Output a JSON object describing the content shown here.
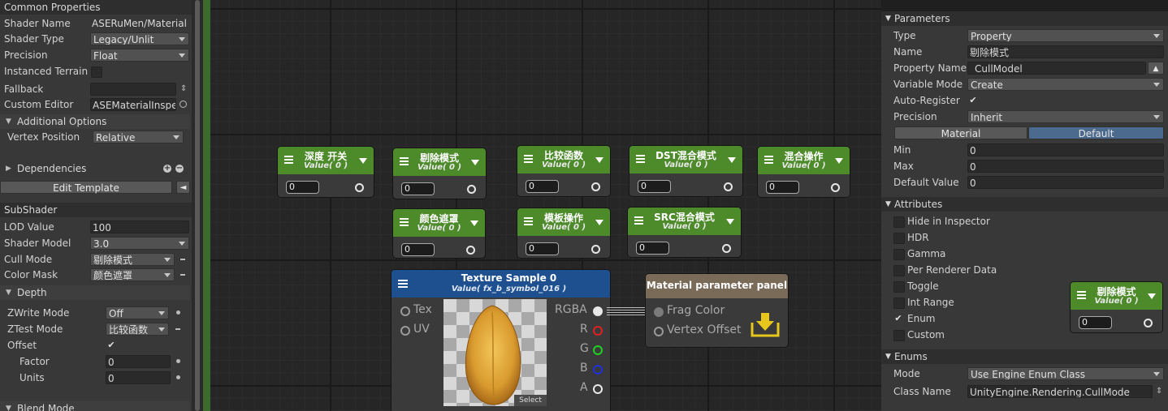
{
  "left_panel": {
    "common_properties": "Common Properties",
    "shader_name_label": "Shader Name",
    "shader_name_value": "ASERuMen/Material",
    "shader_type_label": "Shader Type",
    "shader_type_value": "Legacy/Unlit",
    "precision_label": "Precision",
    "precision_value": "Float",
    "instanced_terrain_label": "Instanced Terrain",
    "fallback_label": "Fallback",
    "fallback_value": "",
    "custom_editor_label": "Custom Editor",
    "custom_editor_value": "ASEMaterialInspe",
    "additional_options": "Additional Options",
    "vertex_position_label": "Vertex Position",
    "vertex_position_value": "Relative",
    "dependencies": "Dependencies",
    "edit_template": "Edit Template",
    "subshader": "SubShader",
    "lod_value_label": "LOD Value",
    "lod_value": "100",
    "shader_model_label": "Shader Model",
    "shader_model_value": "3.0",
    "cull_mode_label": "Cull Mode",
    "cull_mode_value": "剔除模式",
    "color_mask_label": "Color Mask",
    "color_mask_value": "颜色遮罩",
    "depth": "Depth",
    "zwrite_label": "ZWrite Mode",
    "zwrite_value": "Off",
    "ztest_label": "ZTest Mode",
    "ztest_value": "比较函数",
    "offset_label": "Offset",
    "factor_label": "Factor",
    "factor_value": "0",
    "units_label": "Units",
    "units_value": "0",
    "blend_mode": "Blend Mode"
  },
  "canvas": {
    "property_nodes": [
      {
        "title": "深度 开关",
        "value": "Value( 0 )",
        "input": "0"
      },
      {
        "title": "剔除模式",
        "value": "Value( 0 )",
        "input": "0"
      },
      {
        "title": "比较函数",
        "value": "Value( 0 )",
        "input": "0"
      },
      {
        "title": "DST混合模式",
        "value": "Value( 0 )",
        "input": "0"
      },
      {
        "title": "混合操作",
        "value": "Value( 0 )",
        "input": "0"
      },
      {
        "title": "颜色遮罩",
        "value": "Value( 0 )",
        "input": "0"
      },
      {
        "title": "模板操作",
        "value": "Value( 0 )",
        "input": "0"
      },
      {
        "title": "SRC混合模式",
        "value": "Value( 0 )",
        "input": "0"
      }
    ],
    "texture_node": {
      "title": "Texture Sample 0",
      "value": "Value( fx_b_symbol_016 )",
      "in_tex": "Tex",
      "in_uv": "UV",
      "out_rgba": "RGBA",
      "out_r": "R",
      "out_g": "G",
      "out_b": "B",
      "out_a": "A",
      "select": "Select"
    },
    "material_node": {
      "title": "Material parameter panel",
      "frag_color": "Frag Color",
      "vertex_offset": "Vertex Offset"
    },
    "preview_node": {
      "title": "剔除模式",
      "value": "Value( 0 )",
      "input": "0"
    }
  },
  "right_panel": {
    "parameters": "Parameters",
    "type_label": "Type",
    "type_value": "Property",
    "name_label": "Name",
    "name_value": "剔除模式",
    "property_name_label": "Property Name",
    "property_name_value": "_CullModel",
    "variable_mode_label": "Variable Mode",
    "variable_mode_value": "Create",
    "auto_register_label": "Auto-Register",
    "precision_label": "Precision",
    "precision_value": "Inherit",
    "tab_material": "Material",
    "tab_default": "Default",
    "min_label": "Min",
    "min_value": "0",
    "max_label": "Max",
    "max_value": "0",
    "default_value_label": "Default Value",
    "default_value": "0",
    "attributes": "Attributes",
    "attr_hide": "Hide in Inspector",
    "attr_hdr": "HDR",
    "attr_gamma": "Gamma",
    "attr_per_renderer": "Per Renderer Data",
    "attr_toggle": "Toggle",
    "attr_int_range": "Int Range",
    "attr_enum": "Enum",
    "attr_custom": "Custom",
    "enums": "Enums",
    "mode_label": "Mode",
    "mode_value": "Use Engine Enum Class",
    "class_name_label": "Class Name",
    "class_name_value": "UnityEngine.Rendering.CullMode"
  },
  "colors": {
    "node_header": "#4c8a2a",
    "texture_header": "#1e4f8f",
    "material_header": "#7a6a58",
    "tab_active": "#4b6a8d",
    "port_r": "#e02020",
    "port_g": "#20d020",
    "port_b": "#2030e0"
  }
}
